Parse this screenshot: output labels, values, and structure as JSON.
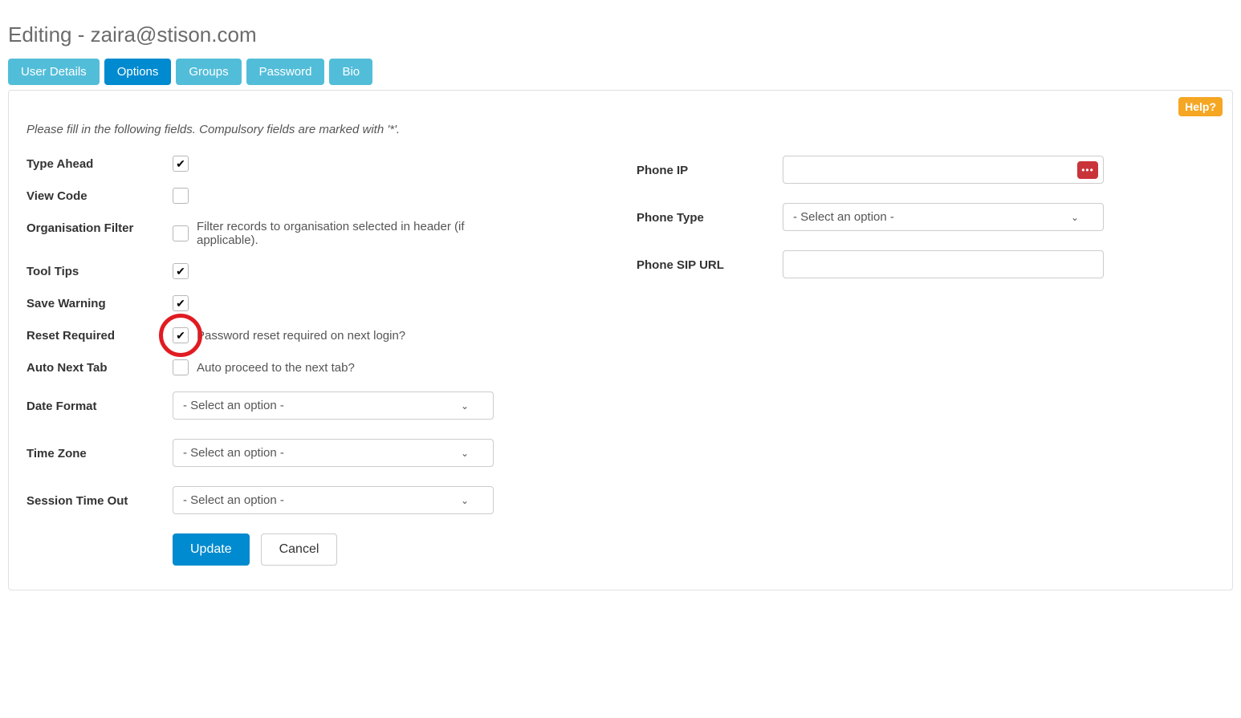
{
  "page": {
    "title": "Editing - zaira@stison.com"
  },
  "tabs": {
    "user_details": "User Details",
    "options": "Options",
    "groups": "Groups",
    "password": "Password",
    "bio": "Bio"
  },
  "help_label": "Help?",
  "intro": "Please fill in the following fields. Compulsory fields are marked with '*'.",
  "left": {
    "type_ahead": {
      "label": "Type Ahead",
      "checked": true
    },
    "view_code": {
      "label": "View Code",
      "checked": false
    },
    "org_filter": {
      "label": "Organisation Filter",
      "checked": false,
      "hint": "Filter records to organisation selected in header (if applicable)."
    },
    "tool_tips": {
      "label": "Tool Tips",
      "checked": true
    },
    "save_warning": {
      "label": "Save Warning",
      "checked": true
    },
    "reset_required": {
      "label": "Reset Required",
      "checked": true,
      "hint": "Password reset required on next login?"
    },
    "auto_next_tab": {
      "label": "Auto Next Tab",
      "checked": false,
      "hint": "Auto proceed to the next tab?"
    },
    "date_format": {
      "label": "Date Format",
      "value": "- Select an option -"
    },
    "time_zone": {
      "label": "Time Zone",
      "value": "- Select an option -"
    },
    "session_timeout": {
      "label": "Session Time Out",
      "value": "- Select an option -"
    }
  },
  "right": {
    "phone_ip": {
      "label": "Phone IP",
      "value": ""
    },
    "phone_type": {
      "label": "Phone Type",
      "value": "- Select an option -"
    },
    "phone_sip_url": {
      "label": "Phone SIP URL",
      "value": ""
    }
  },
  "buttons": {
    "update": "Update",
    "cancel": "Cancel"
  }
}
